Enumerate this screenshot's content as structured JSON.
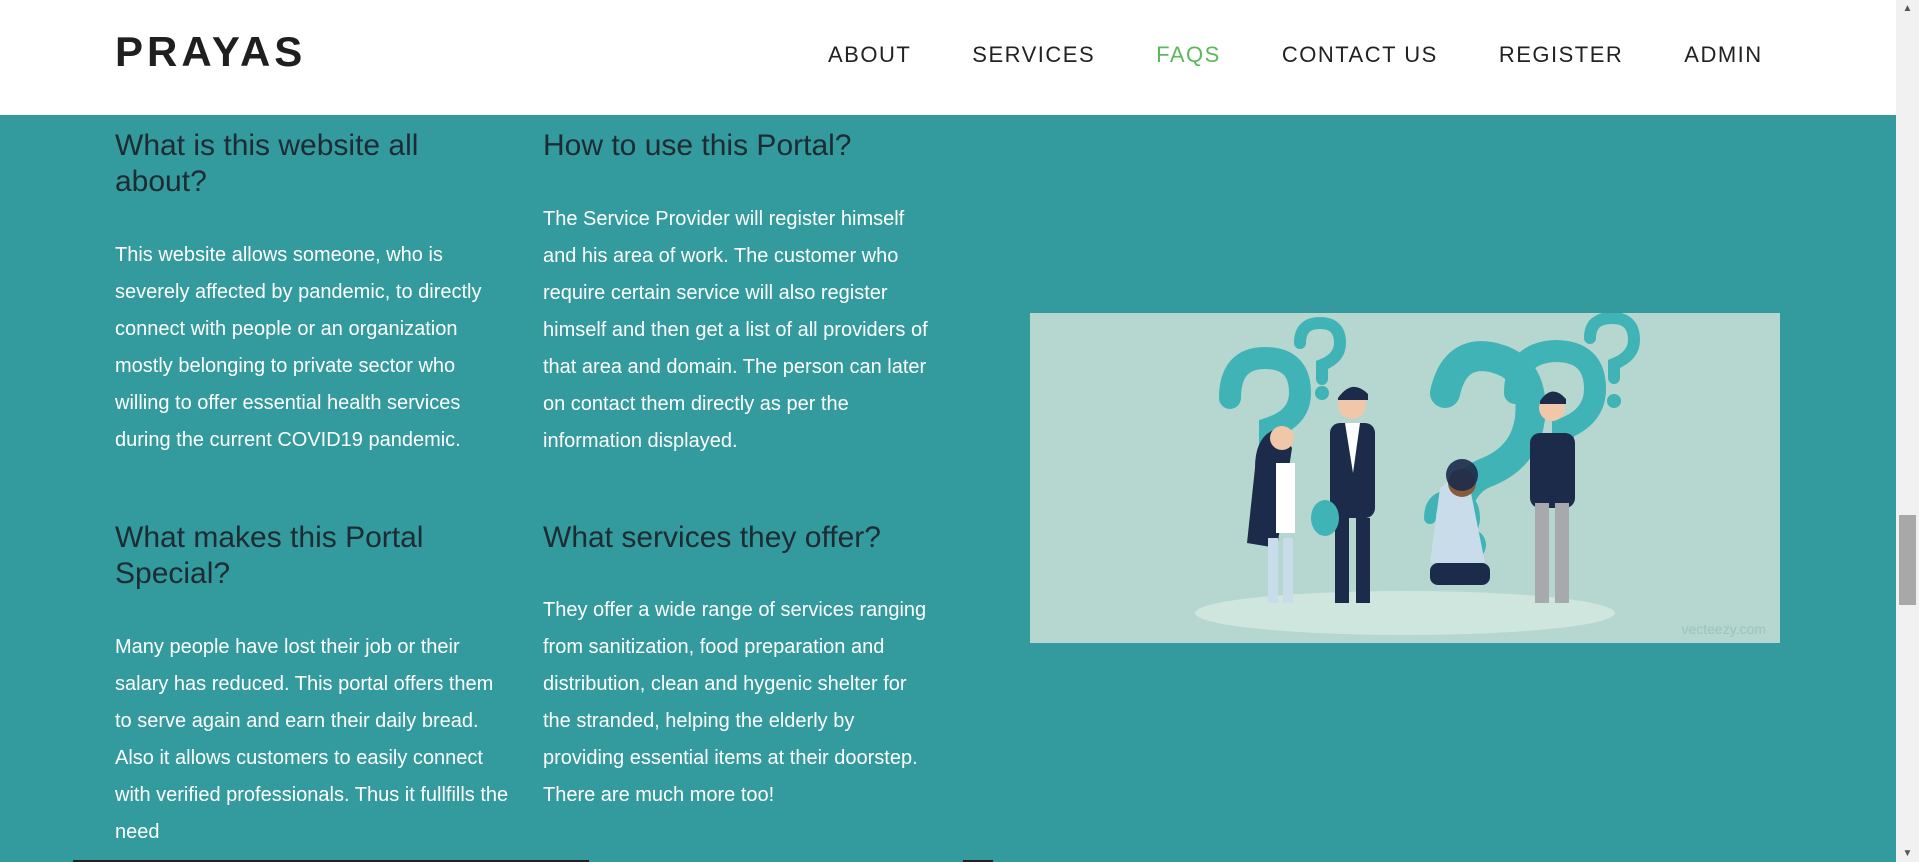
{
  "brand": "PRAYAS",
  "nav": {
    "about": "ABOUT",
    "services": "SERVICES",
    "faqs": "FAQS",
    "contact": "CONTACT US",
    "register": "REGISTER",
    "admin": "ADMIN",
    "active_color": "#5cb85c"
  },
  "faq": [
    {
      "question": "What is this website all about?",
      "answer": "This website allows someone, who is severely affected by pandemic, to directly connect with people or an organization mostly belonging to private sector who willing to offer essential health services during the current COVID19 pandemic."
    },
    {
      "question": "How to use this Portal?",
      "answer": "The Service Provider will register himself and his area of work. The customer who require certain service will also register himself and then get a list of all providers of that area and domain. The person can later on contact them directly as per the information displayed."
    },
    {
      "question": "What makes this Portal Special?",
      "answer": "Many people have lost their job or their salary has reduced. This portal offers them to serve again and earn their daily bread. Also it allows customers to easily connect with verified professionals. Thus it fullfills the need"
    },
    {
      "question": "What services they offer?",
      "answer": "They offer a wide range of services ranging from sanitization, food preparation and distribution, clean and hygenic shelter for the stranded, helping the elderly by providing essential items at their doorstep. There are much more too!"
    }
  ],
  "illustration": {
    "description_icon": "question-people-illustration",
    "watermark": "vecteezy.com"
  },
  "colors": {
    "background": "#339a9e",
    "heading": "#1d2b33",
    "illustration_bg": "#b5d7cf",
    "question_mark": "#3fb3b5",
    "figure_navy": "#1c2b4a"
  }
}
